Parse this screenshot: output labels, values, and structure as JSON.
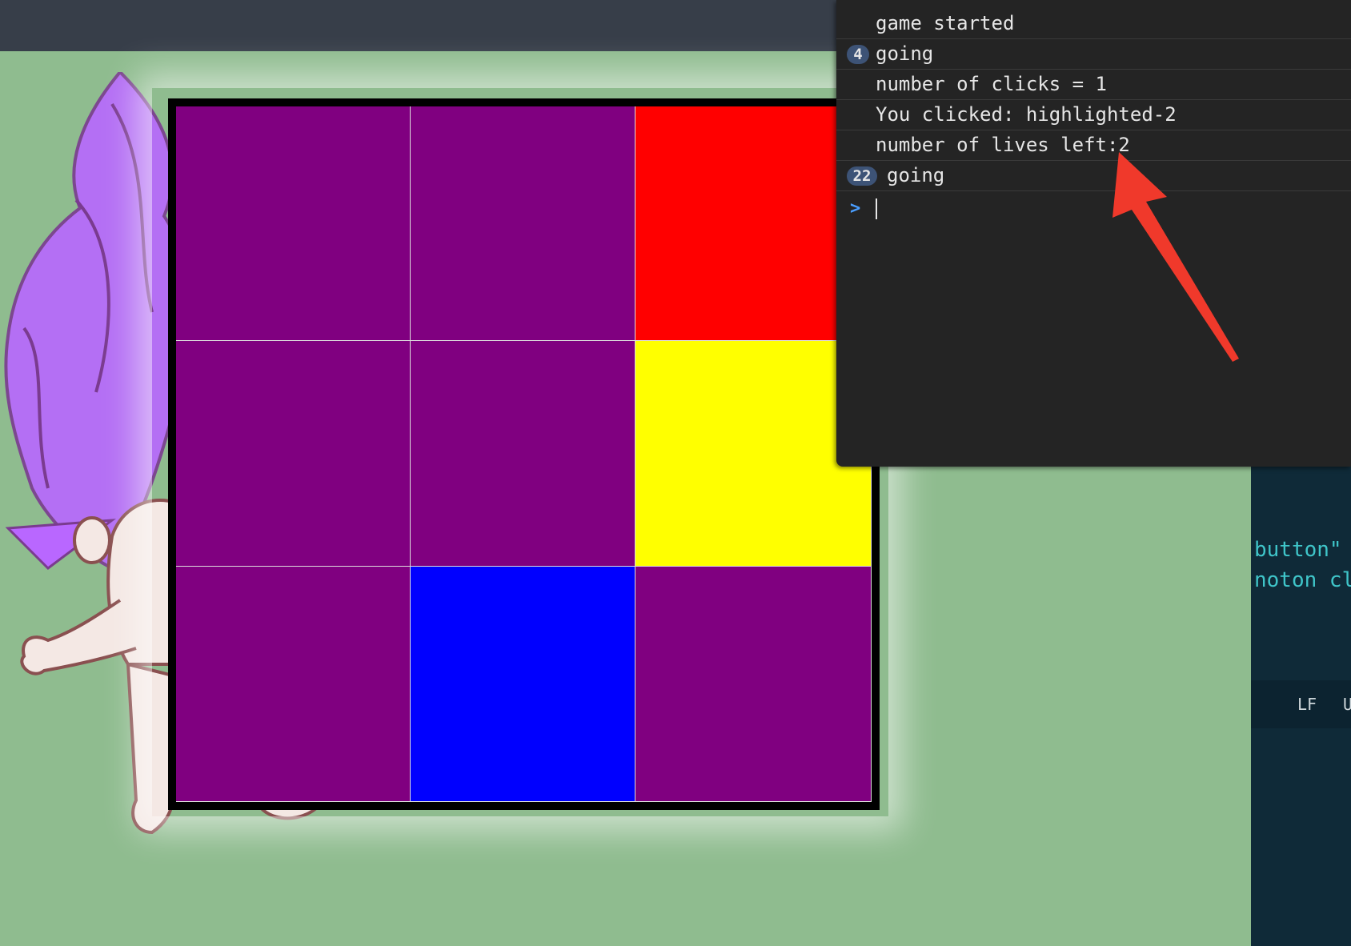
{
  "console": {
    "lines": [
      {
        "count": "",
        "text": "game started"
      },
      {
        "count": "4",
        "text": "going"
      },
      {
        "count": "",
        "text": "number of clicks = 1"
      },
      {
        "count": "",
        "text": "You clicked: highlighted-2"
      },
      {
        "count": "",
        "text": "number of lives left:2"
      },
      {
        "count": "22",
        "text": "going"
      }
    ],
    "prompt": ">"
  },
  "editor": {
    "code_lines": [
      "button\"",
      "noton cl"
    ],
    "status_items": [
      "LF",
      "U"
    ]
  },
  "board": {
    "cells": [
      {
        "color": "#800080"
      },
      {
        "color": "#800080"
      },
      {
        "color": "#ff0000"
      },
      {
        "color": "#800080"
      },
      {
        "color": "#800080"
      },
      {
        "color": "#ffff00"
      },
      {
        "color": "#800080"
      },
      {
        "color": "#0000ff"
      },
      {
        "color": "#800080"
      }
    ]
  },
  "colors": {
    "background": "#8fbc8f",
    "annotation_arrow": "#f0392b"
  },
  "icons": {
    "troll": "troll-doll-illustration",
    "annotation": "red-arrow-icon"
  }
}
